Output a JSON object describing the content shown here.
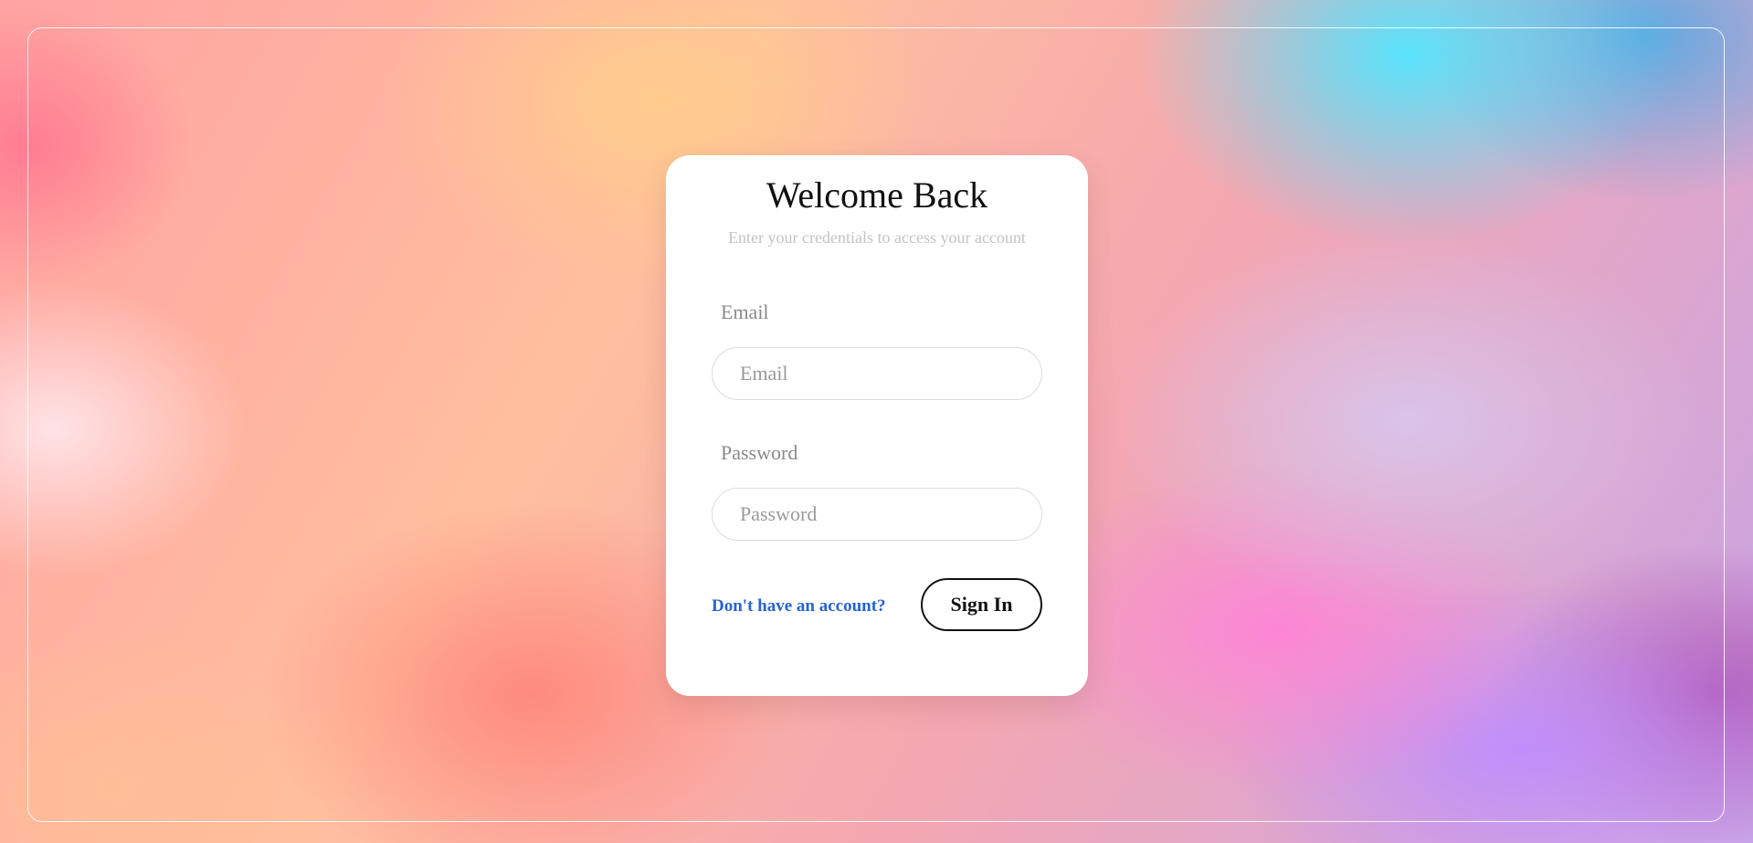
{
  "login": {
    "title": "Welcome Back",
    "subtitle": "Enter your credentials to access your account",
    "email": {
      "label": "Email",
      "placeholder": "Email",
      "value": ""
    },
    "password": {
      "label": "Password",
      "placeholder": "Password",
      "value": ""
    },
    "signup_link": "Don't have an account?",
    "signin_button": "Sign In"
  },
  "colors": {
    "link": "#2563d6",
    "button_border": "#111111",
    "card": "#ffffff"
  }
}
